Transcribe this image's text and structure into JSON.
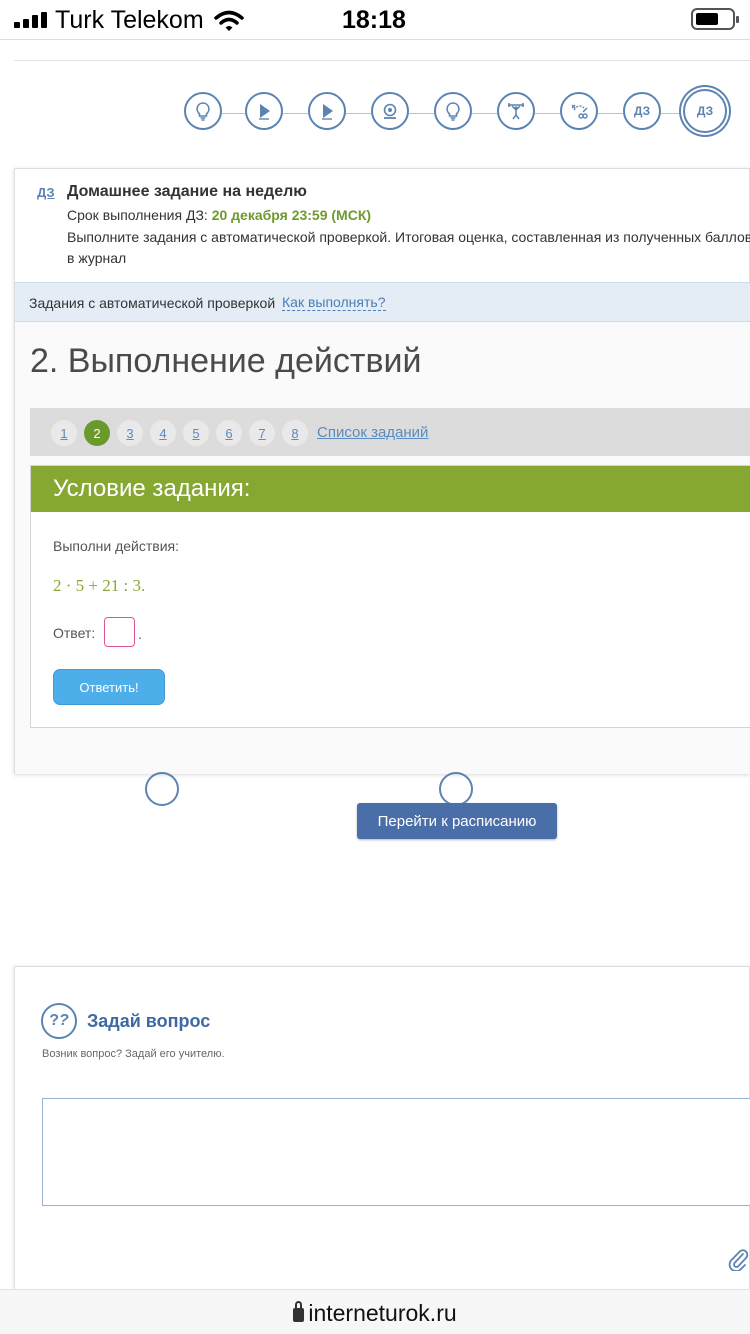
{
  "status_bar": {
    "carrier": "Turk Telekom",
    "time": "18:18"
  },
  "lesson_steps": [
    {
      "icon": "lightbulb-icon"
    },
    {
      "icon": "play-icon"
    },
    {
      "icon": "play-icon"
    },
    {
      "icon": "webcam-icon"
    },
    {
      "icon": "lightbulb-icon"
    },
    {
      "icon": "weightlifter-icon"
    },
    {
      "icon": "tactics-icon"
    },
    {
      "icon": "homework-icon",
      "label": "ДЗ"
    },
    {
      "icon": "homework-icon",
      "label": "ДЗ",
      "active": true
    }
  ],
  "homework": {
    "badge": "ДЗ",
    "title": "Домашнее задание на неделю",
    "deadline_label": "Срок выполнения ДЗ:",
    "deadline_value": "20 декабря 23:59 (МСК)",
    "description_line1": "Выполните задания с автоматической проверкой. Итоговая оценка, составленная из полученных баллов, бу",
    "description_line2": "в журнал",
    "auto_check_label": "Задания с автоматической проверкой",
    "how_to_link": "Как выполнять?"
  },
  "task": {
    "title": "2. Выполнение действий",
    "pages": [
      "1",
      "2",
      "3",
      "4",
      "5",
      "6",
      "7",
      "8"
    ],
    "current_page": "2",
    "task_list_link": "Список заданий",
    "condition_header": "Условие задания:",
    "question": "Выполни действия:",
    "expression": "2 · 5 + 21 : 3.",
    "answer_label": "Ответ:",
    "answer_value": "",
    "answer_suffix": ".",
    "submit_label": "Ответить!"
  },
  "schedule_button": "Перейти к расписанию",
  "ask": {
    "icon_text": "?",
    "title": "Задай вопрос",
    "subtitle": "Возник вопрос? Задай его учителю.",
    "textarea_value": ""
  },
  "browser": {
    "url": "interneturok.ru"
  },
  "colors": {
    "accent_blue": "#5b84b3",
    "green": "#86a833",
    "button_blue": "#4eaeea",
    "schedule_blue": "#4a6ea8"
  }
}
